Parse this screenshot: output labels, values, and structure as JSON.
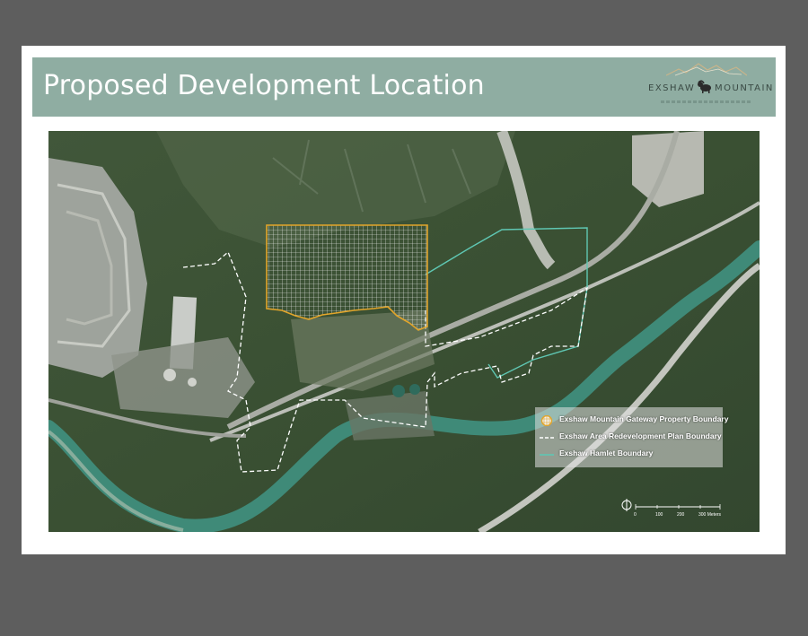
{
  "header": {
    "title": "Proposed Development Location",
    "logo": {
      "word_left": "EXSHAW",
      "word_right": "MOUNTAIN",
      "icon": "bighorn-sheep-icon",
      "mountain_graphic": "mountain-peaks-icon"
    }
  },
  "map": {
    "type": "aerial-satellite",
    "legend": [
      {
        "label": "Exshaw Mountain Gateway Property Boundary",
        "symbol": "grid-hatched-polygon",
        "color": "#e2a52a"
      },
      {
        "label": "Exshaw Area Redevelopment Plan Boundary",
        "symbol": "dashed-line",
        "color": "#ffffff"
      },
      {
        "label": "Exshaw Hamlet Boundary",
        "symbol": "solid-line",
        "color": "#5fc7b3"
      }
    ],
    "scale_bar": {
      "icon": "north-arrow-icon",
      "tick_labels": [
        "0",
        "100",
        "200",
        "300 Meters"
      ]
    }
  },
  "colors": {
    "header_band": "#8fada2",
    "page_background": "#5e5e5e",
    "property_boundary": "#e2a52a",
    "hamlet_boundary": "#5fc7b3",
    "river": "#3f8a78"
  }
}
